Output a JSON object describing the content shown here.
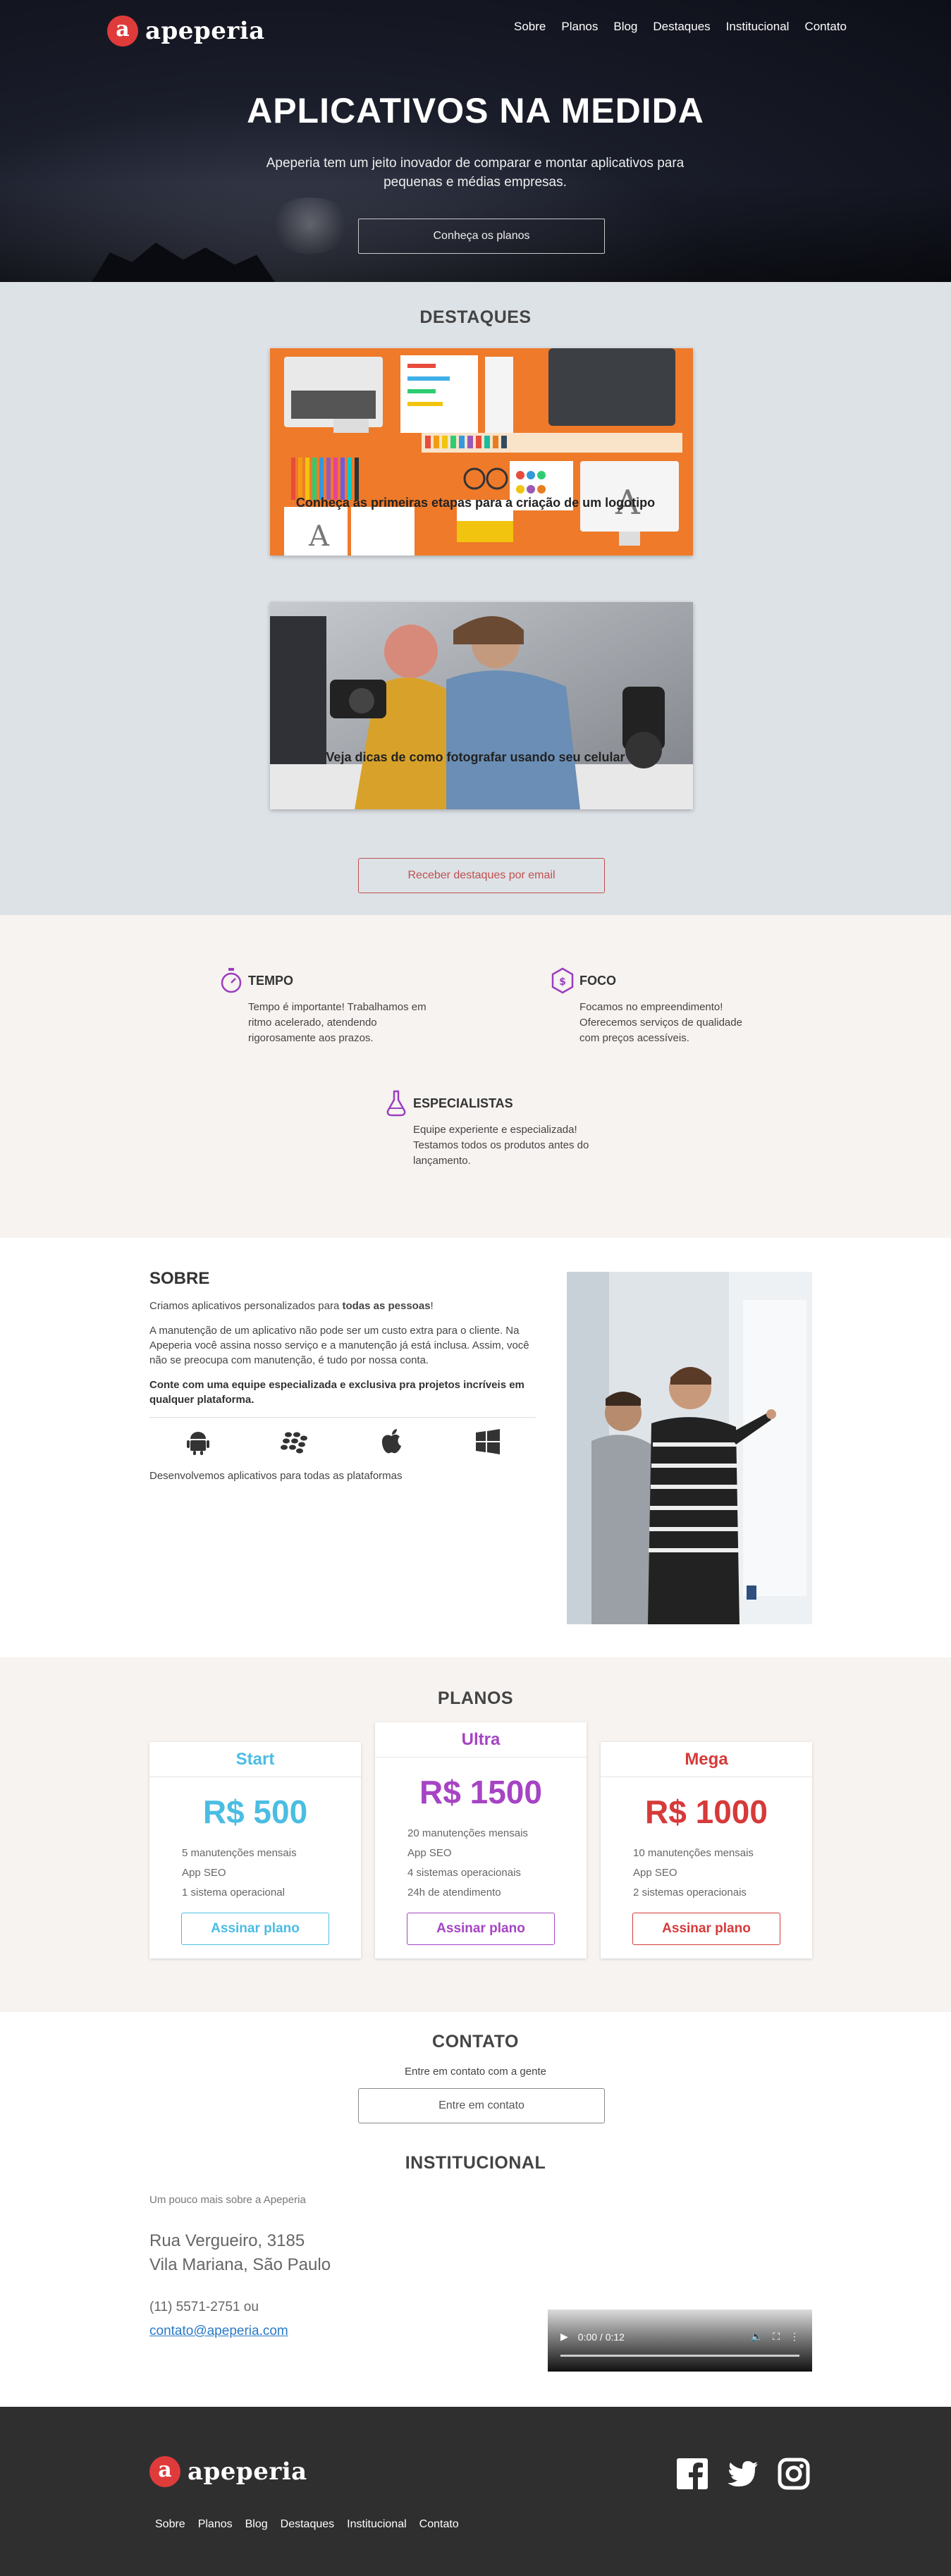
{
  "brand": {
    "name": "apeperia",
    "mark": "a",
    "accent": "#e03b3b"
  },
  "nav": {
    "items": [
      "Sobre",
      "Planos",
      "Blog",
      "Destaques",
      "Institucional",
      "Contato"
    ]
  },
  "hero": {
    "title": "APLICATIVOS NA MEDIDA",
    "subtitle": "Apeperia tem um jeito inovador de comparar e montar aplicativos para pequenas e médias empresas.",
    "cta": "Conheça os planos"
  },
  "destaques": {
    "title": "DESTAQUES",
    "items": [
      {
        "caption": "Conheça as primeiras etapas para a criação de um logotipo"
      },
      {
        "caption": "Veja dicas de como fotografar usando seu celular"
      }
    ],
    "cta": "Receber destaques por email"
  },
  "features": [
    {
      "title": "TEMPO",
      "icon": "stopwatch-icon",
      "text": "Tempo é importante! Trabalhamos em ritmo acelerado, atendendo rigorosamente aos prazos."
    },
    {
      "title": "FOCO",
      "icon": "dollar-hexagon-icon",
      "text": "Focamos no empreendimento! Oferecemos serviços de qualidade com preços acessíveis."
    },
    {
      "title": "ESPECIALISTAS",
      "icon": "flask-icon",
      "text": "Equipe experiente e especializada! Testamos todos os produtos antes do lançamento."
    }
  ],
  "sobre": {
    "title": "SOBRE",
    "p1_prefix": "Criamos aplicativos personalizados para ",
    "p1_bold": "todas as pessoas",
    "p1_suffix": "!",
    "p2": "A manutenção de um aplicativo não pode ser um custo extra para o cliente. Na Apeperia você assina nosso serviço e a manutenção já está inclusa. Assim, você não se preocupa com manutenção, é tudo por nossa conta.",
    "p3": "Conte com uma equipe especializada e exclusiva pra projetos incríveis em qualquer plataforma.",
    "platforms": [
      "android-icon",
      "blackberry-icon",
      "apple-icon",
      "windows-icon"
    ],
    "platforms_text": "Desenvolvemos aplicativos para todas as plataformas"
  },
  "planos": {
    "title": "PLANOS",
    "cards": [
      {
        "name": "Start",
        "price": "R$ 500",
        "color": "#4bbde3",
        "features": [
          "5 manutenções mensais",
          "App SEO",
          "1 sistema operacional"
        ],
        "cta": "Assinar plano"
      },
      {
        "name": "Ultra",
        "price": "R$ 1500",
        "color": "#a644c4",
        "features": [
          "20 manutenções mensais",
          "App SEO",
          "4 sistemas operacionais",
          "24h de atendimento"
        ],
        "cta": "Assinar plano"
      },
      {
        "name": "Mega",
        "price": "R$ 1000",
        "color": "#d63a3a",
        "features": [
          "10 manutenções mensais",
          "App SEO",
          "2 sistemas operacionais"
        ],
        "cta": "Assinar plano"
      }
    ]
  },
  "contato": {
    "title": "CONTATO",
    "text": "Entre em contato com a gente",
    "cta": "Entre em contato"
  },
  "institucional": {
    "title": "INSTITUCIONAL",
    "lead": "Um pouco mais sobre a Apeperia",
    "address_line1": "Rua Vergueiro, 3185",
    "address_line2": "Vila Mariana, São Paulo",
    "phone": "(11) 5571-2751 ou",
    "email": "contato@apeperia.com",
    "video_time": "0:00 / 0:12"
  },
  "footer": {
    "social": [
      "facebook-icon",
      "twitter-icon",
      "instagram-icon"
    ],
    "menu": [
      "Sobre",
      "Planos",
      "Blog",
      "Destaques",
      "Institucional",
      "Contato"
    ]
  }
}
